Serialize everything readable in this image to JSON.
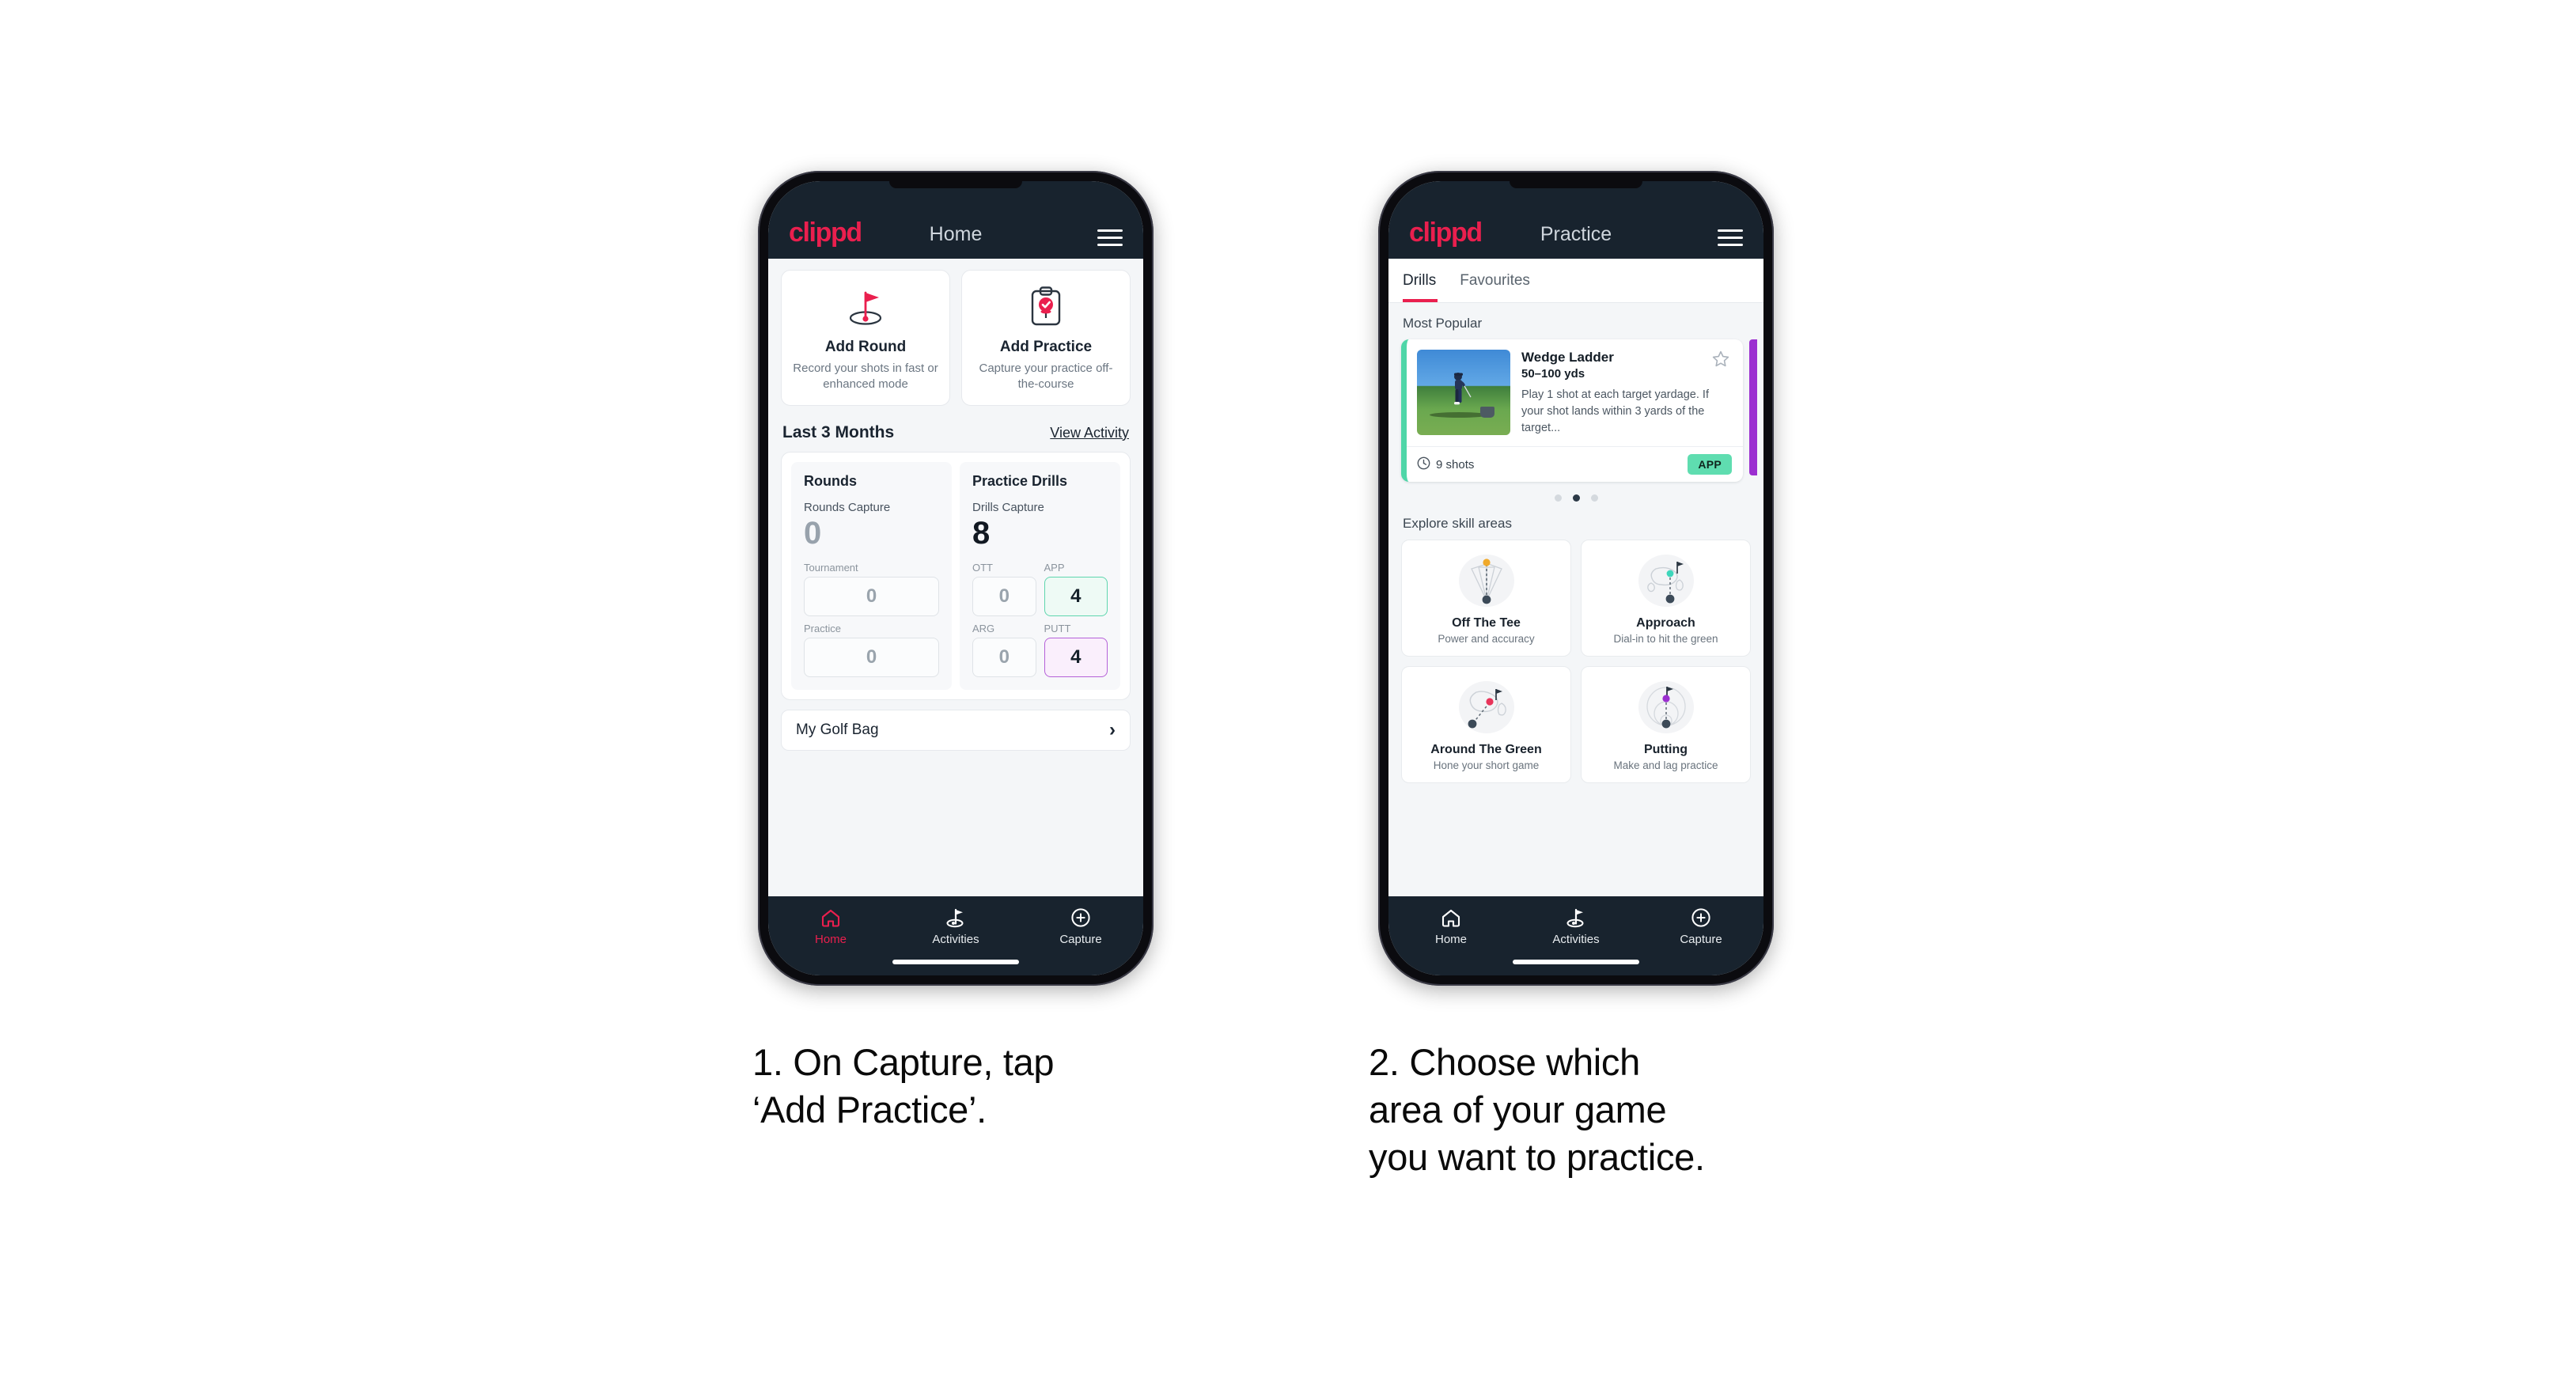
{
  "brand": "clippd",
  "colors": {
    "accent_pink": "#ea1f4e",
    "header_navy": "#18232e",
    "teal": "#5fddb0",
    "purple": "#9b2fd0",
    "page_bg": "#ffffff"
  },
  "phone1": {
    "header": {
      "title": "Home",
      "menu_icon": "hamburger-icon"
    },
    "actions": [
      {
        "icon": "golf-flag-icon",
        "title": "Add Round",
        "sub": "Record your shots in fast or enhanced mode"
      },
      {
        "icon": "clipboard-check-icon",
        "title": "Add Practice",
        "sub": "Capture your practice off-the-course"
      }
    ],
    "section": {
      "title": "Last 3 Months",
      "link": "View Activity"
    },
    "rounds": {
      "heading": "Rounds",
      "capture_label": "Rounds Capture",
      "capture_value": "0",
      "minis": [
        {
          "label": "Tournament",
          "value": "0",
          "state": "default"
        },
        {
          "label": "Practice",
          "value": "0",
          "state": "default"
        }
      ]
    },
    "drills": {
      "heading": "Practice Drills",
      "capture_label": "Drills Capture",
      "capture_value": "8",
      "minis": [
        {
          "label": "OTT",
          "value": "0",
          "state": "default"
        },
        {
          "label": "APP",
          "value": "4",
          "state": "teal"
        },
        {
          "label": "ARG",
          "value": "0",
          "state": "default"
        },
        {
          "label": "PUTT",
          "value": "4",
          "state": "purple"
        }
      ]
    },
    "bag": {
      "label": "My Golf Bag",
      "chevron": "chevron-right-icon"
    },
    "nav": [
      {
        "label": "Home",
        "icon": "home-icon",
        "active": true
      },
      {
        "label": "Activities",
        "icon": "golf-flag-icon",
        "active": false
      },
      {
        "label": "Capture",
        "icon": "plus-circle-icon",
        "active": false
      }
    ]
  },
  "phone2": {
    "header": {
      "title": "Practice",
      "menu_icon": "hamburger-icon"
    },
    "tabs": [
      {
        "label": "Drills",
        "active": true
      },
      {
        "label": "Favourites",
        "active": false
      }
    ],
    "most_popular_label": "Most Popular",
    "drill": {
      "name": "Wedge Ladder",
      "yardage": "50–100 yds",
      "description": "Play 1 shot at each target yardage. If your shot lands within 3 yards of the target...",
      "shots": "9 shots",
      "shots_icon": "clock-icon",
      "badge": "APP",
      "favourite_icon": "star-outline-icon",
      "accent": "#4fd6a8",
      "next_accent": "#9b2fd0"
    },
    "carousel": {
      "count": 3,
      "active_index": 1
    },
    "explore_label": "Explore skill areas",
    "skills": [
      {
        "title": "Off The Tee",
        "sub": "Power and accuracy",
        "art": "tee-fan-icon",
        "dot": "#f0a92a"
      },
      {
        "title": "Approach",
        "sub": "Dial-in to hit the green",
        "art": "green-approach-icon",
        "dot": "#3ed6bb"
      },
      {
        "title": "Around The Green",
        "sub": "Hone your short game",
        "art": "chip-green-icon",
        "dot": "#e8345a"
      },
      {
        "title": "Putting",
        "sub": "Make and lag practice",
        "art": "putting-rings-icon",
        "dot": "#9b2fd0"
      }
    ],
    "nav": [
      {
        "label": "Home",
        "icon": "home-icon",
        "active": false
      },
      {
        "label": "Activities",
        "icon": "golf-flag-icon",
        "active": false
      },
      {
        "label": "Capture",
        "icon": "plus-circle-icon",
        "active": false
      }
    ]
  },
  "captions": {
    "one": "1. On Capture, tap\n‘Add Practice’.",
    "two": "2. Choose which\narea of your game\nyou want to practice."
  }
}
